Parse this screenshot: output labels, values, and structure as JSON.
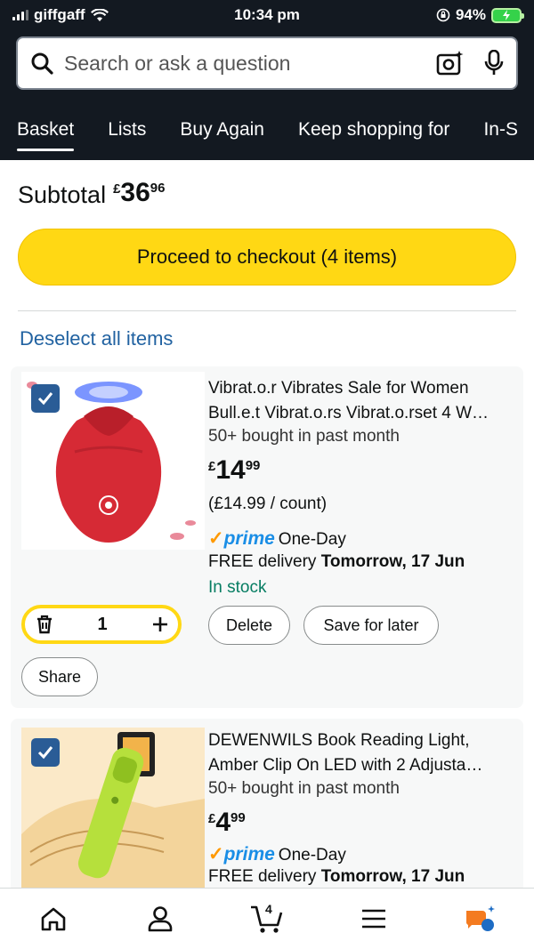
{
  "status_bar": {
    "carrier": "giffgaff",
    "time": "10:34 pm",
    "battery": "94%"
  },
  "search": {
    "placeholder": "Search or ask a question"
  },
  "tabs": [
    {
      "label": "Basket",
      "active": true
    },
    {
      "label": "Lists"
    },
    {
      "label": "Buy Again"
    },
    {
      "label": "Keep shopping for"
    },
    {
      "label": "In-S"
    }
  ],
  "subtotal": {
    "label": "Subtotal",
    "currency": "£",
    "whole": "36",
    "fraction": "96"
  },
  "checkout": {
    "label": "Proceed to checkout (4 items)"
  },
  "deselect": {
    "label": "Deselect all items"
  },
  "items": [
    {
      "title_line1": "Vibrat.o.r Vibrates Sale for Women",
      "title_line2": "Bull.e.t Vibrat.o.rs Vibrat.o.rset 4 W…",
      "bought": "50+ bought in past month",
      "price": {
        "currency": "£",
        "whole": "14",
        "fraction": "99"
      },
      "unit_price": "(£14.99 / count)",
      "prime_label": "prime",
      "delivery_type": "One-Day",
      "delivery_prefix": "FREE delivery ",
      "delivery_date": "Tomorrow, 17 Jun",
      "stock": "In stock",
      "quantity": "1",
      "delete_label": "Delete",
      "save_label": "Save for later",
      "share_label": "Share"
    },
    {
      "title_line1": "DEWENWILS Book Reading Light,",
      "title_line2": "Amber Clip On LED with 2 Adjusta…",
      "bought": "50+ bought in past month",
      "price": {
        "currency": "£",
        "whole": "4",
        "fraction": "99"
      },
      "prime_label": "prime",
      "delivery_type": "One-Day",
      "delivery_prefix": "FREE delivery ",
      "delivery_date": "Tomorrow, 17 Jun"
    }
  ],
  "bottom_nav": {
    "cart_count": "4"
  },
  "colors": {
    "header_bg": "#131921",
    "checkout_yellow": "#ffd814",
    "link_blue": "#2162a1",
    "prime_blue": "#1a8ee6",
    "stock_green": "#067d62"
  }
}
